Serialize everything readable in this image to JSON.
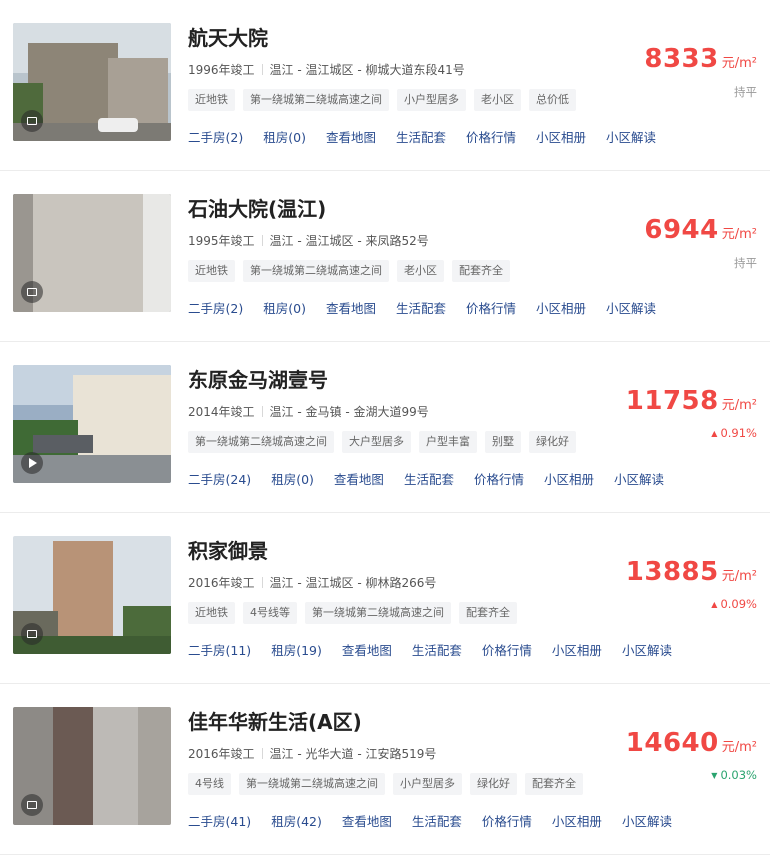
{
  "colors": {
    "price": "#f04844",
    "link": "#2a4c8f",
    "up": "#f04844",
    "down": "#2aa46f",
    "flat": "#999999"
  },
  "links": [
    "二手房",
    "租房",
    "查看地图",
    "生活配套",
    "价格行情",
    "小区相册",
    "小区解读"
  ],
  "items": [
    {
      "title": "航天大院",
      "year": "1996年竣工",
      "district": "温江 - 温江城区 - 柳城大道东段41号",
      "tags": [
        "近地铁",
        "第一绕城第二绕城高速之间",
        "小户型居多",
        "老小区",
        "总价低"
      ],
      "counts": [
        "(2)",
        "(0)"
      ],
      "price": "8333",
      "unit": "元/m²",
      "trend": "持平",
      "trend_dir": "flat",
      "badge_icon": "photo-icon"
    },
    {
      "title": "石油大院(温江)",
      "year": "1995年竣工",
      "district": "温江 - 温江城区 - 来凤路52号",
      "tags": [
        "近地铁",
        "第一绕城第二绕城高速之间",
        "老小区",
        "配套齐全"
      ],
      "counts": [
        "(2)",
        "(0)"
      ],
      "price": "6944",
      "unit": "元/m²",
      "trend": "持平",
      "trend_dir": "flat",
      "badge_icon": "photo-icon"
    },
    {
      "title": "东原金马湖壹号",
      "year": "2014年竣工",
      "district": "温江 - 金马镇 - 金湖大道99号",
      "tags": [
        "第一绕城第二绕城高速之间",
        "大户型居多",
        "户型丰富",
        "别墅",
        "绿化好"
      ],
      "counts": [
        "(24)",
        "(0)"
      ],
      "price": "11758",
      "unit": "元/m²",
      "trend": "0.91%",
      "trend_dir": "up",
      "badge_icon": "video-play-icon"
    },
    {
      "title": "积家御景",
      "year": "2016年竣工",
      "district": "温江 - 温江城区 - 柳林路266号",
      "tags": [
        "近地铁",
        "4号线等",
        "第一绕城第二绕城高速之间",
        "配套齐全"
      ],
      "counts": [
        "(11)",
        "(19)"
      ],
      "price": "13885",
      "unit": "元/m²",
      "trend": "0.09%",
      "trend_dir": "up",
      "badge_icon": "photo-icon"
    },
    {
      "title": "佳年华新生活(A区)",
      "year": "2016年竣工",
      "district": "温江 - 光华大道 - 江安路519号",
      "tags": [
        "4号线",
        "第一绕城第二绕城高速之间",
        "小户型居多",
        "绿化好",
        "配套齐全"
      ],
      "counts": [
        "(41)",
        "(42)"
      ],
      "price": "14640",
      "unit": "元/m²",
      "trend": "0.03%",
      "trend_dir": "down",
      "badge_icon": "photo-icon"
    }
  ]
}
